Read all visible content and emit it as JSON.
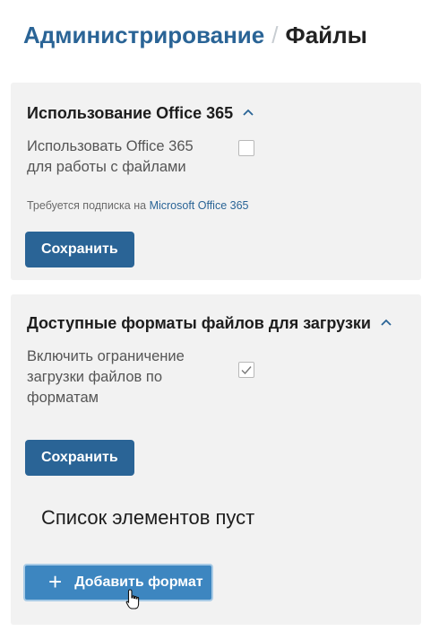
{
  "breadcrumb": {
    "parent": "Администрирование",
    "separator": "/",
    "current": "Файлы"
  },
  "office_section": {
    "title": "Использование Office 365",
    "option_label": "Использовать Office 365 для работы с файлами",
    "checked": false,
    "note_prefix": "Требуется подписка на",
    "note_link": "Microsoft Office 365",
    "save_label": "Сохранить"
  },
  "formats_section": {
    "title": "Доступные форматы файлов для загрузки",
    "option_label": "Включить ограничение загрузки файлов по форматам",
    "checked": true,
    "save_label": "Сохранить",
    "empty_message": "Список элементов пуст",
    "add_label": "Добавить формат"
  },
  "colors": {
    "accent": "#2a6496",
    "add_button": "#3d86c0",
    "card_bg": "#f2f2f2"
  },
  "icons": [
    "chevron-up-icon",
    "checkmark-icon",
    "plus-icon",
    "hand-cursor-icon"
  ]
}
